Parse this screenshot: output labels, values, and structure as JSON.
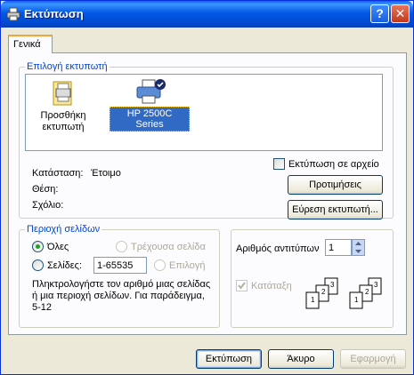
{
  "window": {
    "title": "Εκτύπωση",
    "help_glyph": "?",
    "close_glyph": "✕"
  },
  "tabs": [
    {
      "label": "Γενικά"
    }
  ],
  "select_printer": {
    "group_label": "Επιλογή εκτυπωτή",
    "printers": [
      {
        "label": "Προσθήκη εκτυπωτή",
        "icon": "add-printer-icon",
        "selected": false
      },
      {
        "label": "HP 2500C Series",
        "icon": "printer-icon",
        "selected": true
      }
    ],
    "status_label": "Κατάσταση:",
    "status_value": "Έτοιμο",
    "location_label": "Θέση:",
    "comment_label": "Σχόλιο:",
    "print_to_file_label": "Εκτύπωση σε αρχείο",
    "preferences_button": "Προτιμήσεις",
    "find_printer_button": "Εύρεση εκτυπωτή..."
  },
  "page_range": {
    "group_label": "Περιοχή σελίδων",
    "all_label": "Όλες",
    "current_page_label": "Τρέχουσα σελίδα",
    "pages_label": "Σελίδες:",
    "pages_value": "1-65535",
    "selection_label": "Επιλογή",
    "help_text_line1": "Πληκτρολογήστε τον αριθμό μιας σελίδας",
    "help_text_line2": "ή μια περιοχή σελίδων.  Για παράδειγμα,",
    "help_text_line3": "5-12"
  },
  "copies": {
    "count_label": "Αριθμός αντιτύπων",
    "count_value": "1",
    "collate_label": "Κατάταξη"
  },
  "footer": {
    "print_button": "Εκτύπωση",
    "cancel_button": "Άκυρο",
    "apply_button": "Εφαρμογή"
  },
  "colors": {
    "title_bar": "#0058e6",
    "group_label": "#0046d5",
    "selection": "#316ac5"
  }
}
